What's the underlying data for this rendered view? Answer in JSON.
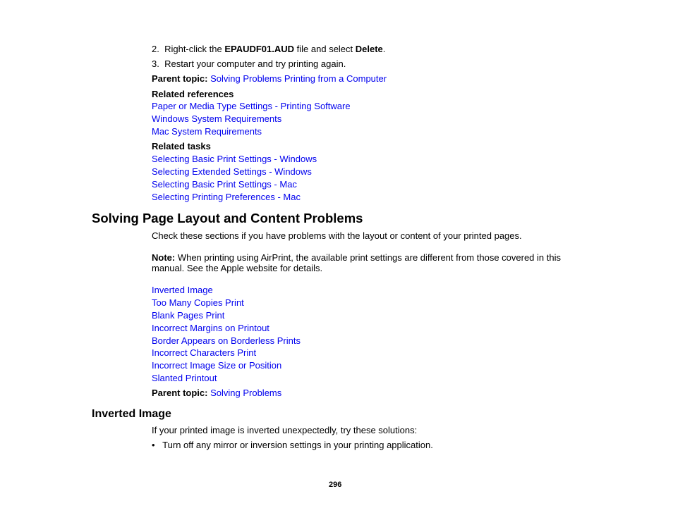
{
  "steps": {
    "step2": {
      "num": "2.",
      "pre": "Right-click the ",
      "file": "EPAUDF01.AUD",
      "mid": " file and select ",
      "action": "Delete",
      "post": "."
    },
    "step3": {
      "num": "3.",
      "text": "Restart your computer and try printing again."
    }
  },
  "parent_topic_1": {
    "label": "Parent topic:",
    "link": "Solving Problems Printing from a Computer"
  },
  "related_references": {
    "heading": "Related references",
    "links": [
      "Paper or Media Type Settings - Printing Software",
      "Windows System Requirements",
      "Mac System Requirements"
    ]
  },
  "related_tasks": {
    "heading": "Related tasks",
    "links": [
      "Selecting Basic Print Settings - Windows",
      "Selecting Extended Settings - Windows",
      "Selecting Basic Print Settings - Mac",
      "Selecting Printing Preferences - Mac"
    ]
  },
  "section": {
    "title": "Solving Page Layout and Content Problems",
    "intro": "Check these sections if you have problems with the layout or content of your printed pages.",
    "note_label": "Note:",
    "note_line1": " When printing using AirPrint, the available print settings are different from those covered in this",
    "note_line2": "manual. See the Apple website for details.",
    "links": [
      "Inverted Image",
      "Too Many Copies Print",
      "Blank Pages Print",
      "Incorrect Margins on Printout",
      "Border Appears on Borderless Prints",
      "Incorrect Characters Print",
      "Incorrect Image Size or Position",
      "Slanted Printout"
    ]
  },
  "parent_topic_2": {
    "label": "Parent topic:",
    "link": "Solving Problems"
  },
  "subsection": {
    "title": "Inverted Image",
    "intro": "If your printed image is inverted unexpectedly, try these solutions:",
    "bullet_char": "•",
    "bullets": [
      "Turn off any mirror or inversion settings in your printing application."
    ]
  },
  "page_number": "296"
}
